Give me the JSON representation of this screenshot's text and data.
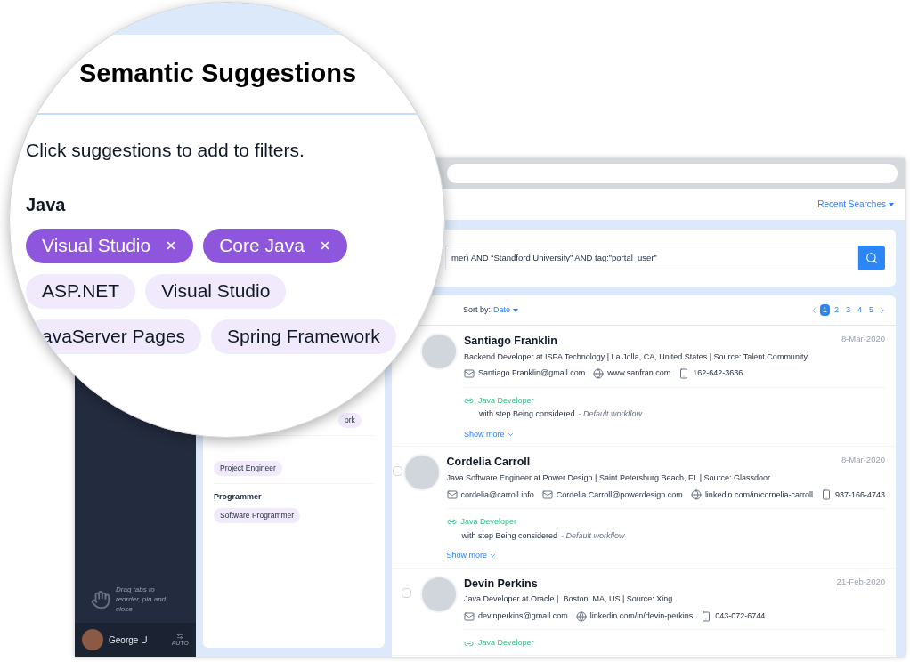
{
  "magnifier": {
    "title": "Semantic Suggestions",
    "instruction": "Click suggestions to add to filters.",
    "group": "Java",
    "chips": [
      {
        "label": "Visual Studio",
        "selected": true
      },
      {
        "label": "Core Java",
        "selected": true
      },
      {
        "label": "ASP.NET",
        "selected": false
      },
      {
        "label": "Visual Studio",
        "selected": false
      },
      {
        "label": "avaServer Pages",
        "selected": false
      },
      {
        "label": "Spring Framework",
        "selected": false
      }
    ]
  },
  "header": {
    "recent_searches": "Recent Searches"
  },
  "sidebar": {
    "hint": "Drag tabs to reorder, pin and close",
    "user": "George U",
    "toggle_label": "AUTO"
  },
  "filters": {
    "groups": [
      {
        "chips": [
          "ork"
        ]
      },
      {
        "chips": [
          "Project Engineer"
        ]
      },
      {
        "heading": "Programmer",
        "chips": [
          "Software Programmer"
        ]
      }
    ]
  },
  "search": {
    "query": "mer) AND “Standford University” AND tag:”portal_user”"
  },
  "results": {
    "sort_label": "Sort by:",
    "sort_value": "Date",
    "pages": [
      {
        "label": "1",
        "selected": true
      },
      {
        "label": "2",
        "selected": false
      },
      {
        "label": "3",
        "selected": false
      },
      {
        "label": "4",
        "selected": false
      },
      {
        "label": "5",
        "selected": false
      }
    ],
    "candidates": [
      {
        "name": "Santiago Franklin",
        "date": "8-Mar-2020",
        "headline": "Backend Developer at ISPA Technology | La Jolla, CA, United States | Source: Talent Community",
        "contacts": [
          {
            "kind": "email",
            "text": "Santiago.Franklin@gmail.com"
          },
          {
            "kind": "web",
            "text": "www.sanfran.com"
          },
          {
            "kind": "phone",
            "text": "162-642-3636"
          }
        ],
        "job": {
          "title": "Java Developer",
          "step": "with step Being considered",
          "workflow": "- Default workflow"
        },
        "show_more": "Show more"
      },
      {
        "checked": false,
        "name": "Cordelia Carroll",
        "date": "8-Mar-2020",
        "headline": "Java Software Engineer at Power Design | Saint Petersburg Beach, FL | Source: Glassdoor",
        "contacts": [
          {
            "kind": "email",
            "text": "cordelia@carroll.info"
          },
          {
            "kind": "email",
            "text": "Cordelia.Carroll@powerdesign.com"
          },
          {
            "kind": "web",
            "text": "linkedin.com/in/cornelia-carroll"
          },
          {
            "kind": "phone",
            "text": "937-166-4743"
          }
        ],
        "job": {
          "title": "Java Developer",
          "step": "with step Being considered",
          "workflow": "- Default workflow"
        },
        "show_more": "Show more"
      },
      {
        "checked": false,
        "name": "Devin Perkins",
        "date": "21-Feb-2020",
        "headline": "Java Developer at Oracle |  Boston, MA, US | Source: Xing",
        "contacts": [
          {
            "kind": "email",
            "text": "devinperkins@gmail.com"
          },
          {
            "kind": "web",
            "text": "linkedin.com/in/devin-perkins"
          },
          {
            "kind": "phone",
            "text": "043-072-6744"
          }
        ],
        "job": {
          "title": "Java Developer"
        }
      }
    ]
  }
}
